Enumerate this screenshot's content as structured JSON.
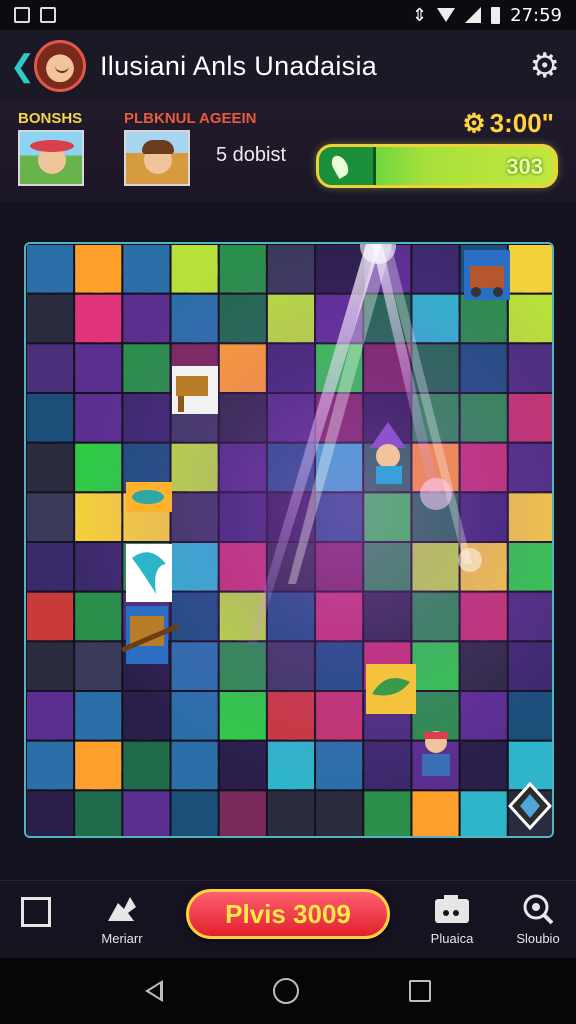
{
  "status_bar": {
    "time": "27:59",
    "icons": [
      "image-icon",
      "sd-card-icon",
      "vibrate-icon",
      "wifi-icon",
      "signal-icon",
      "battery-icon"
    ]
  },
  "header": {
    "title": "Ilusiani Anls Unadaisia",
    "back_icon": "chevron-left-icon",
    "settings_icon": "gear-icon"
  },
  "players": {
    "left_label": "BONSHS",
    "right_label": "PLBKNUL AGEEIN",
    "status_text": "5 dobist"
  },
  "timer": {
    "value": "3:00\"",
    "icon": "gear-icon"
  },
  "score": {
    "value": "303"
  },
  "colors": {
    "accent_teal": "#30c8c8",
    "gold": "#ffd33d",
    "left_label": "#f0d64a",
    "right_label": "#e65c3c",
    "play_button": "#e1202f",
    "score_green": "#2ecc45"
  },
  "bottom_bar": {
    "left_icon": "square-icon",
    "items": [
      {
        "label": "Meriarr",
        "icon": "puzzle-piece-icon"
      },
      {
        "label": "Pluaica",
        "icon": "camera-icon"
      },
      {
        "label": "Sloubio",
        "icon": "search-icon"
      }
    ],
    "play_label": "Plvis 3009"
  },
  "system_nav": [
    "back-icon",
    "home-icon",
    "recent-apps-icon"
  ]
}
